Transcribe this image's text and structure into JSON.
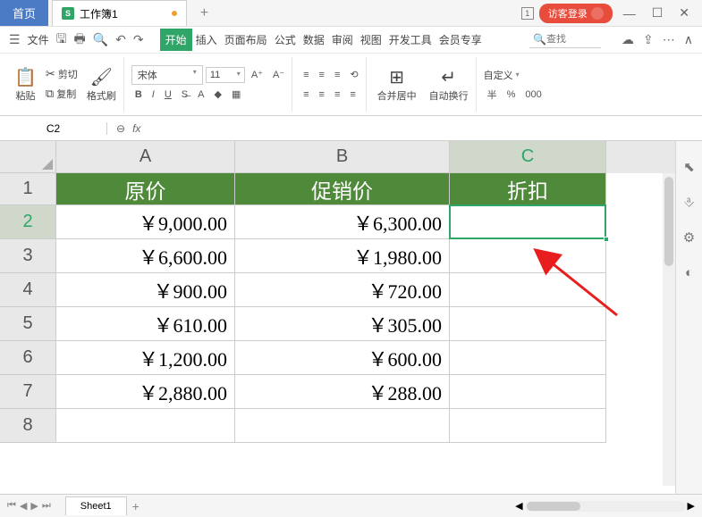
{
  "titlebar": {
    "home": "首页",
    "doc_icon": "S",
    "doc_name": "工作簿1",
    "guest_login": "访客登录",
    "window_number": "1"
  },
  "menubar": {
    "file": "文件",
    "tabs": {
      "start": "开始",
      "insert": "插入",
      "layout": "页面布局",
      "formula": "公式",
      "data": "数据",
      "review": "审阅",
      "view": "视图",
      "dev": "开发工具",
      "member": "会员专享"
    },
    "search_placeholder": "查找"
  },
  "ribbon": {
    "paste": "粘贴",
    "cut": "剪切",
    "copy": "复制",
    "format_painter": "格式刷",
    "font_name": "宋体",
    "font_size": "11",
    "merge_center": "合并居中",
    "auto_wrap": "自动换行",
    "custom": "自定义",
    "currency": "半",
    "percent": "%",
    "thousands": "000"
  },
  "namebox": {
    "value": "C2"
  },
  "fx": {
    "label": "fx"
  },
  "grid": {
    "columns": [
      "A",
      "B",
      "C"
    ],
    "selected_column": "C",
    "selected_row": "2",
    "header": {
      "A": "原价",
      "B": "促销价",
      "C": "折扣"
    },
    "rows": [
      {
        "n": "1"
      },
      {
        "n": "2",
        "A": "￥9,000.00",
        "B": "￥6,300.00",
        "C": ""
      },
      {
        "n": "3",
        "A": "￥6,600.00",
        "B": "￥1,980.00",
        "C": ""
      },
      {
        "n": "4",
        "A": "￥900.00",
        "B": "￥720.00",
        "C": ""
      },
      {
        "n": "5",
        "A": "￥610.00",
        "B": "￥305.00",
        "C": ""
      },
      {
        "n": "6",
        "A": "￥1,200.00",
        "B": "￥600.00",
        "C": ""
      },
      {
        "n": "7",
        "A": "￥2,880.00",
        "B": "￥288.00",
        "C": ""
      },
      {
        "n": "8",
        "A": "",
        "B": "",
        "C": ""
      }
    ]
  },
  "sheets": {
    "tab1": "Sheet1"
  }
}
